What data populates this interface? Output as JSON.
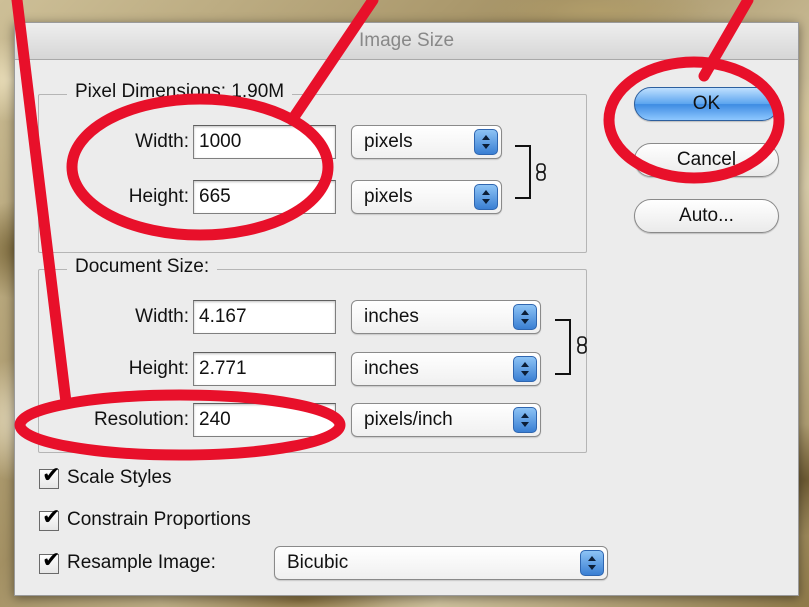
{
  "dialog": {
    "title": "Image Size",
    "buttons": {
      "ok": "OK",
      "cancel": "Cancel",
      "auto": "Auto..."
    }
  },
  "pixel_dimensions": {
    "legend": "Pixel Dimensions:",
    "size": "1.90M",
    "width_label": "Width:",
    "width_value": "1000",
    "width_unit": "pixels",
    "height_label": "Height:",
    "height_value": "665",
    "height_unit": "pixels"
  },
  "document_size": {
    "legend": "Document Size:",
    "width_label": "Width:",
    "width_value": "4.167",
    "width_unit": "inches",
    "height_label": "Height:",
    "height_value": "2.771",
    "height_unit": "inches",
    "resolution_label": "Resolution:",
    "resolution_value": "240",
    "resolution_unit": "pixels/inch"
  },
  "options": {
    "scale_styles": {
      "label": "Scale Styles",
      "checked": true
    },
    "constrain_proportions": {
      "label": "Constrain Proportions",
      "checked": true
    },
    "resample_image": {
      "label": "Resample Image:",
      "checked": true,
      "method": "Bicubic"
    }
  },
  "icons": {
    "chain": "chain-link-icon",
    "select_arrows": "up-down-arrows-icon",
    "check": "checkmark-icon"
  },
  "colors": {
    "annotation_red": "#e8102a",
    "ok_blue": "#3d8be2"
  }
}
